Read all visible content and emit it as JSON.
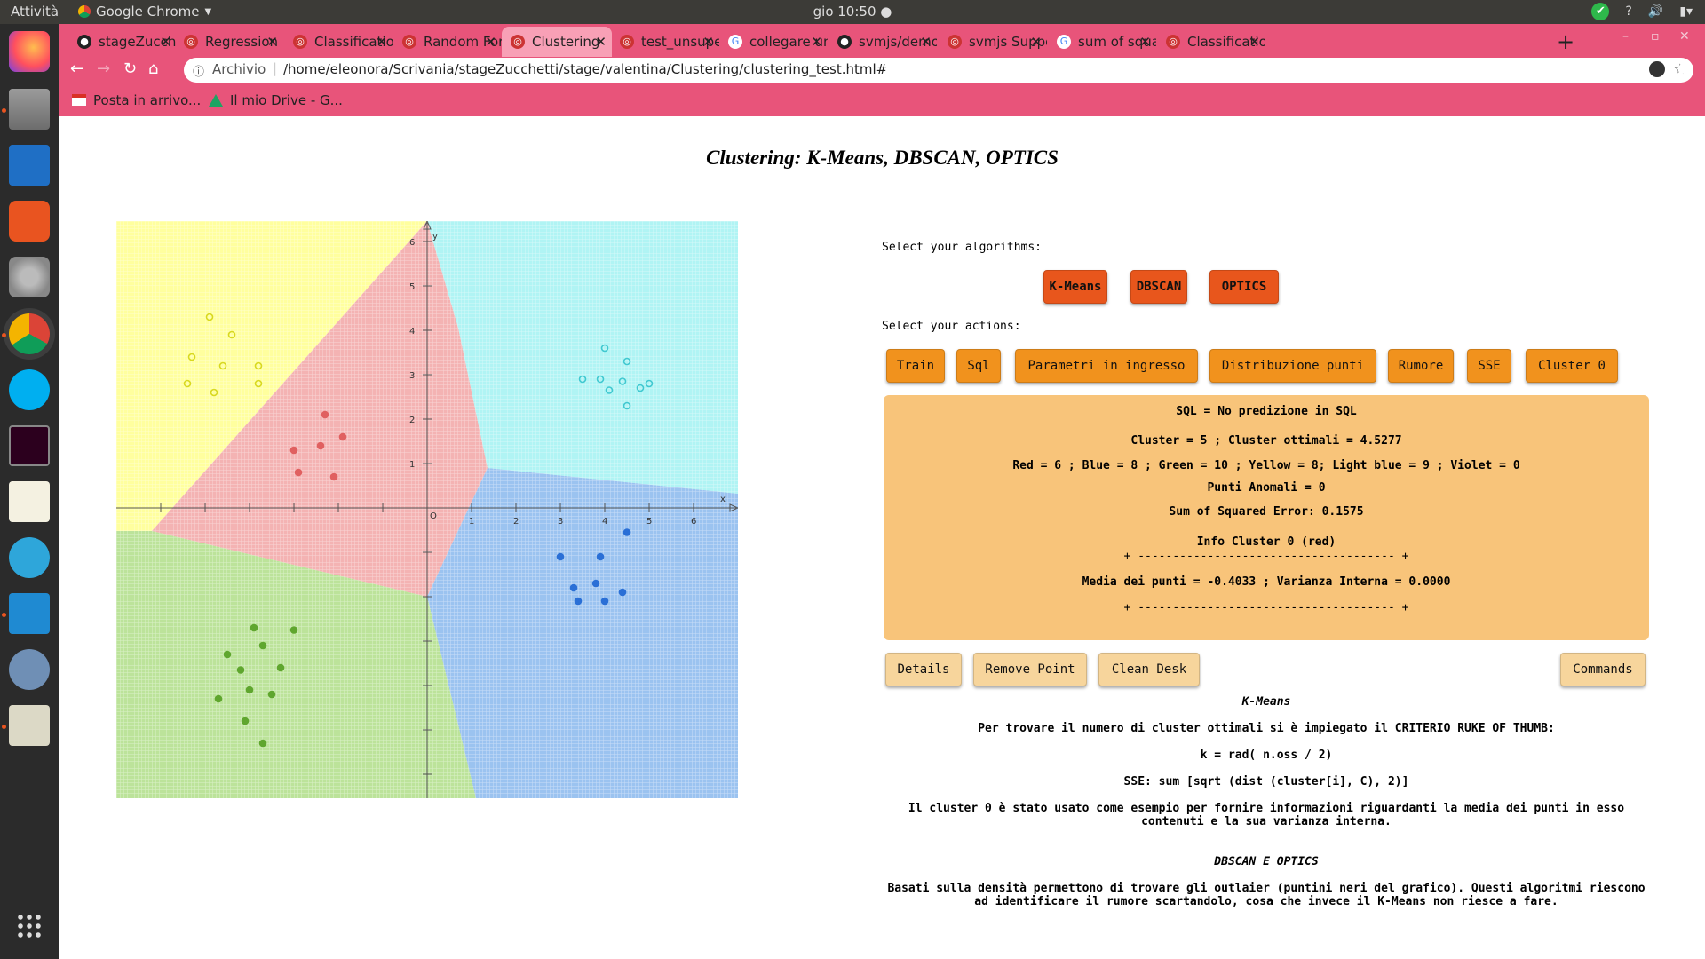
{
  "topbar": {
    "activities": "Attività",
    "app_name": "Google Chrome",
    "clock": "gio 10:50"
  },
  "tabs": [
    {
      "label": "stageZucche",
      "favicon": "github-icon"
    },
    {
      "label": "Regression",
      "favicon": "chrome-page-icon"
    },
    {
      "label": "Classificatio",
      "favicon": "chrome-page-icon"
    },
    {
      "label": "Random For",
      "favicon": "chrome-page-icon"
    },
    {
      "label": "Clustering",
      "favicon": "chrome-page-icon"
    },
    {
      "label": "test_unsupe",
      "favicon": "chrome-page-icon"
    },
    {
      "label": "collegare un",
      "favicon": "google-icon"
    },
    {
      "label": "svmjs/demo",
      "favicon": "github-icon"
    },
    {
      "label": "svmjs Suppo",
      "favicon": "chrome-page-icon"
    },
    {
      "label": "sum of squa",
      "favicon": "google-icon"
    },
    {
      "label": "Classificatio",
      "favicon": "chrome-page-icon"
    }
  ],
  "address": {
    "badge": "Archivio",
    "url": "/home/eleonora/Scrivania/stageZucchetti/stage/valentina/Clustering/clustering_test.html#"
  },
  "bookmarks": [
    "Posta in arrivo...",
    "Il mio Drive - G..."
  ],
  "page": {
    "title": "Clustering: K-Means, DBSCAN, OPTICS",
    "select_algorithms": "Select your algorithms:",
    "algorithms": [
      "K-Means",
      "DBSCAN",
      "OPTICS"
    ],
    "select_actions": "Select your actions:",
    "actions": [
      "Train",
      "Sql",
      "Parametri in ingresso",
      "Distribuzione punti",
      "Rumore",
      "SSE",
      "Cluster 0"
    ],
    "panel": {
      "sql": "SQL = No predizione in SQL",
      "clusters": "Cluster = 5 ; Cluster ottimali = 4.5277",
      "counts": "Red = 6 ; Blue = 8 ; Green = 10 ; Yellow = 8; Light blue = 9 ; Violet = 0",
      "anomalies": "Punti Anomali = 0",
      "sse": "Sum of Squared Error: 0.1575",
      "info_title": "Info Cluster 0 (red)",
      "separator": "+ ------------------------------------- +",
      "stats": "Media dei punti = -0.4033 ; Varianza Interna = 0.0000"
    },
    "bottom_buttons": [
      "Details",
      "Remove Point",
      "Clean Desk",
      "Commands"
    ],
    "desc": {
      "kmeans_title": "K-Means",
      "kmeans_line1": "Per trovare il numero di cluster ottimali si è impiegato il CRITERIO RUKE OF THUMB:",
      "kmeans_formula": "k = rad( n.oss / 2)",
      "sse_formula": "SSE: sum [sqrt (dist (cluster[i], C), 2)]",
      "cluster0_note": "Il cluster 0 è stato usato come esempio per fornire informazioni riguardanti la media dei punti in esso contenuti e la sua varianza interna.",
      "dbscan_title": "DBSCAN E OPTICS",
      "dbscan_note": "Basati sulla densità permettono di trovare gli outlaier (puntini neri del grafico). Questi algoritmi riescono ad identificare il rumore scartandolo, cosa che invece il K-Means non riesce a fare."
    }
  },
  "colors": {
    "red": "#e06060",
    "blue": "#2a6fd6",
    "green": "#5fa62e",
    "yellow": "#d8d820",
    "lightblue": "#40c8d0"
  },
  "chart_data": {
    "type": "scatter",
    "xlabel": "x",
    "ylabel": "y",
    "xticks": [
      "1",
      "2",
      "3",
      "4",
      "5",
      "6"
    ],
    "yticks": [
      "1",
      "2",
      "3",
      "4",
      "5",
      "6"
    ],
    "origin_label": "O",
    "xlim": [
      -7,
      7
    ],
    "ylim": [
      -6.5,
      6.5
    ],
    "series": [
      {
        "color": "red",
        "points": [
          [
            -2.3,
            2.1
          ],
          [
            -1.9,
            1.6
          ],
          [
            -3.0,
            1.3
          ],
          [
            -2.4,
            1.4
          ],
          [
            -2.9,
            0.8
          ],
          [
            -2.1,
            0.7
          ]
        ]
      },
      {
        "color": "yellow",
        "points": [
          [
            -4.9,
            4.3
          ],
          [
            -4.4,
            3.9
          ],
          [
            -5.3,
            3.4
          ],
          [
            -4.6,
            3.2
          ],
          [
            -3.8,
            3.2
          ],
          [
            -5.4,
            2.8
          ],
          [
            -3.8,
            2.8
          ],
          [
            -4.8,
            2.6
          ]
        ]
      },
      {
        "color": "lightblue",
        "points": [
          [
            4.0,
            3.6
          ],
          [
            4.5,
            3.3
          ],
          [
            3.5,
            2.9
          ],
          [
            3.9,
            2.9
          ],
          [
            4.4,
            2.85
          ],
          [
            5.0,
            2.8
          ],
          [
            4.1,
            2.65
          ],
          [
            4.8,
            2.7
          ],
          [
            4.5,
            2.3
          ]
        ]
      },
      {
        "color": "blue",
        "points": [
          [
            4.5,
            -0.55
          ],
          [
            3.0,
            -1.1
          ],
          [
            3.9,
            -1.1
          ],
          [
            3.3,
            -1.8
          ],
          [
            3.8,
            -1.7
          ],
          [
            4.4,
            -1.9
          ],
          [
            3.4,
            -2.1
          ],
          [
            4.0,
            -2.1
          ]
        ]
      },
      {
        "color": "green",
        "points": [
          [
            -3.9,
            -2.7
          ],
          [
            -3.0,
            -2.75
          ],
          [
            -3.7,
            -3.1
          ],
          [
            -4.5,
            -3.3
          ],
          [
            -3.3,
            -3.6
          ],
          [
            -4.2,
            -3.65
          ],
          [
            -4.0,
            -4.1
          ],
          [
            -3.5,
            -4.2
          ],
          [
            -4.7,
            -4.3
          ],
          [
            -4.1,
            -4.8
          ],
          [
            -3.7,
            -5.3
          ]
        ]
      }
    ]
  }
}
